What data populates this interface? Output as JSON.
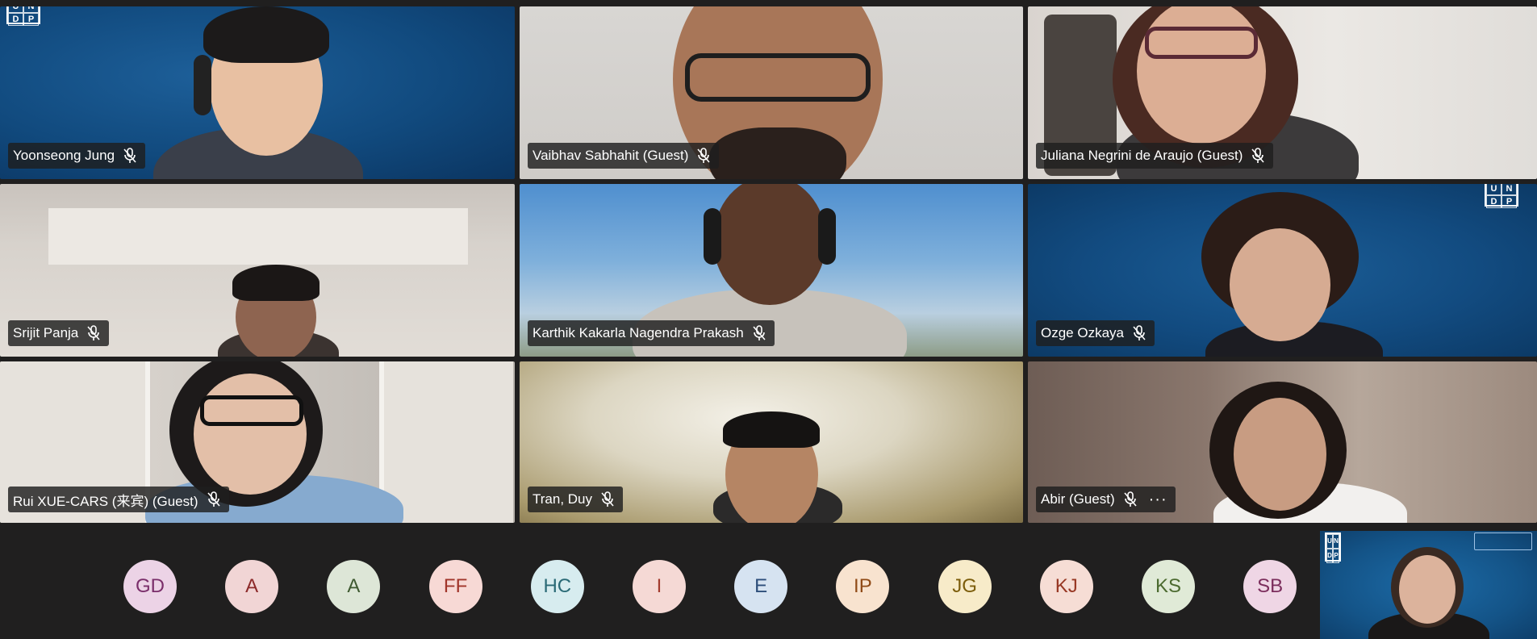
{
  "participants": [
    {
      "name": "Yoonseong Jung",
      "muted": true
    },
    {
      "name": "Vaibhav Sabhahit (Guest)",
      "muted": true
    },
    {
      "name": "Juliana Negrini de Araujo (Guest)",
      "muted": true
    },
    {
      "name": "Srijit Panja",
      "muted": true
    },
    {
      "name": "Karthik Kakarla Nagendra Prakash",
      "muted": true
    },
    {
      "name": "Ozge Ozkaya",
      "muted": true
    },
    {
      "name": "Rui XUE-CARS (来宾) (Guest)",
      "muted": true
    },
    {
      "name": "Tran, Duy",
      "muted": true
    },
    {
      "name": "Abir (Guest)",
      "muted": true,
      "more": "···"
    }
  ],
  "logos": {
    "undp_a": [
      "U",
      "N",
      "D",
      "P"
    ],
    "undp_b": [
      "U",
      "N",
      "D",
      "P"
    ],
    "undp_c": [
      "U",
      "N",
      "D",
      "P"
    ]
  },
  "avatars": [
    {
      "initials": "GD",
      "bg": "#ecd3e6",
      "fg": "#7a2e6a"
    },
    {
      "initials": "A",
      "bg": "#f1d5d5",
      "fg": "#8c2a2a"
    },
    {
      "initials": "A",
      "bg": "#dde6d7",
      "fg": "#3f5a31"
    },
    {
      "initials": "FF",
      "bg": "#f7d9d5",
      "fg": "#a1352a"
    },
    {
      "initials": "HC",
      "bg": "#d7ecef",
      "fg": "#2a6a76"
    },
    {
      "initials": "I",
      "bg": "#f5d9d5",
      "fg": "#a23b2e"
    },
    {
      "initials": "E",
      "bg": "#d6e3f1",
      "fg": "#2d4e7a"
    },
    {
      "initials": "IP",
      "bg": "#f8e3cf",
      "fg": "#8f4a16"
    },
    {
      "initials": "JG",
      "bg": "#f7ebc9",
      "fg": "#7c5d0b"
    },
    {
      "initials": "KJ",
      "bg": "#f6ddd5",
      "fg": "#973723"
    },
    {
      "initials": "KS",
      "bg": "#e0ead7",
      "fg": "#4b6a2f"
    },
    {
      "initials": "SB",
      "bg": "#efd6e5",
      "fg": "#7b2d5c"
    }
  ]
}
